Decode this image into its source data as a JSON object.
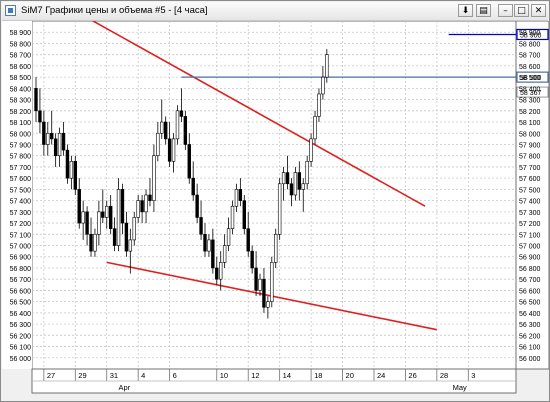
{
  "window": {
    "title": "SiM7 Графики цены и объема #5 - [4 часа]",
    "buttons": [
      {
        "name": "arrow-down-button",
        "glyph": "⬇"
      },
      {
        "name": "menu-button",
        "glyph": "▤"
      },
      {
        "name": "minimize-button",
        "glyph": "–"
      },
      {
        "name": "maximize-button",
        "glyph": "□"
      },
      {
        "name": "close-button",
        "glyph": "✕"
      }
    ]
  },
  "chart_data": {
    "type": "candlestick",
    "title": "",
    "ylim": [
      55900,
      59000
    ],
    "y_ticks": [
      56000,
      56100,
      56200,
      56300,
      56400,
      56500,
      56600,
      56700,
      56800,
      56900,
      57000,
      57100,
      57200,
      57300,
      57400,
      57500,
      57600,
      57700,
      57800,
      57900,
      58000,
      58100,
      58200,
      58300,
      58400,
      58500,
      58600,
      58700,
      58800,
      58900
    ],
    "x_tick_labels": [
      {
        "label": "27",
        "i": 2
      },
      {
        "label": "29",
        "i": 10
      },
      {
        "label": "31",
        "i": 18
      },
      {
        "label": "4",
        "i": 26
      },
      {
        "label": "6",
        "i": 34
      },
      {
        "label": "10",
        "i": 46
      },
      {
        "label": "12",
        "i": 54
      },
      {
        "label": "14",
        "i": 62
      },
      {
        "label": "18",
        "i": 70
      },
      {
        "label": "20",
        "i": 78
      },
      {
        "label": "24",
        "i": 86
      },
      {
        "label": "26",
        "i": 94
      },
      {
        "label": "28",
        "i": 102
      },
      {
        "label": "3",
        "i": 110
      }
    ],
    "month_labels": [
      {
        "label": "Apr",
        "i": 21
      },
      {
        "label": "May",
        "i": 106
      }
    ],
    "candles": [
      [
        58400,
        58500,
        58100,
        58200
      ],
      [
        58200,
        58400,
        58000,
        58100
      ],
      [
        58100,
        58200,
        57800,
        57900
      ],
      [
        57900,
        58100,
        57800,
        58000
      ],
      [
        58000,
        58200,
        57900,
        57950
      ],
      [
        57950,
        58000,
        57700,
        57800
      ],
      [
        57800,
        58050,
        57700,
        58000
      ],
      [
        58000,
        58100,
        57800,
        57850
      ],
      [
        57850,
        57900,
        57550,
        57600
      ],
      [
        57600,
        57800,
        57500,
        57750
      ],
      [
        57750,
        57800,
        57450,
        57500
      ],
      [
        57500,
        57600,
        57150,
        57200
      ],
      [
        57200,
        57400,
        57050,
        57300
      ],
      [
        57300,
        57350,
        57000,
        57100
      ],
      [
        57100,
        57250,
        56900,
        56950
      ],
      [
        56950,
        57150,
        56900,
        57100
      ],
      [
        57100,
        57400,
        57000,
        57300
      ],
      [
        57300,
        57500,
        57200,
        57250
      ],
      [
        57250,
        57400,
        57150,
        57350
      ],
      [
        57350,
        57450,
        57100,
        57150
      ],
      [
        57150,
        57250,
        56950,
        57000
      ],
      [
        57000,
        57600,
        56950,
        57500
      ],
      [
        57500,
        57550,
        57100,
        57200
      ],
      [
        57200,
        57300,
        56900,
        56950
      ],
      [
        56950,
        57150,
        56750,
        57050
      ],
      [
        57050,
        57300,
        57000,
        57250
      ],
      [
        57250,
        57450,
        57200,
        57400
      ],
      [
        57400,
        57450,
        57200,
        57300
      ],
      [
        57300,
        57500,
        57200,
        57450
      ],
      [
        57450,
        57600,
        57350,
        57400
      ],
      [
        57400,
        57900,
        57300,
        57800
      ],
      [
        57800,
        58100,
        57750,
        58000
      ],
      [
        58000,
        58300,
        57950,
        58100
      ],
      [
        58100,
        58150,
        57900,
        57950
      ],
      [
        57950,
        58100,
        57700,
        57750
      ],
      [
        57750,
        58000,
        57650,
        57950
      ],
      [
        57950,
        58250,
        57900,
        58200
      ],
      [
        58200,
        58400,
        58100,
        58150
      ],
      [
        58150,
        58200,
        57850,
        57900
      ],
      [
        57900,
        58000,
        57550,
        57600
      ],
      [
        57600,
        57750,
        57400,
        57450
      ],
      [
        57450,
        57550,
        57200,
        57250
      ],
      [
        57250,
        57400,
        57050,
        57100
      ],
      [
        57100,
        57200,
        56900,
        56950
      ],
      [
        56950,
        57100,
        56900,
        57050
      ],
      [
        57050,
        57150,
        56750,
        56800
      ],
      [
        56800,
        56900,
        56650,
        56700
      ],
      [
        56700,
        56950,
        56600,
        56850
      ],
      [
        56850,
        57100,
        56800,
        57000
      ],
      [
        57000,
        57250,
        56950,
        57150
      ],
      [
        57150,
        57400,
        57100,
        57350
      ],
      [
        57350,
        57550,
        57300,
        57500
      ],
      [
        57500,
        57600,
        57350,
        57400
      ],
      [
        57400,
        57450,
        57100,
        57150
      ],
      [
        57150,
        57300,
        56900,
        56950
      ],
      [
        56950,
        57000,
        56750,
        56800
      ],
      [
        56800,
        56950,
        56550,
        56600
      ],
      [
        56600,
        56750,
        56550,
        56700
      ],
      [
        56700,
        56800,
        56400,
        56450
      ],
      [
        56450,
        56550,
        56350,
        56500
      ],
      [
        56500,
        56900,
        56450,
        56850
      ],
      [
        56850,
        57150,
        56800,
        57100
      ],
      [
        57100,
        57600,
        57050,
        57550
      ],
      [
        57550,
        57700,
        57400,
        57650
      ],
      [
        57650,
        57800,
        57500,
        57550
      ],
      [
        57550,
        57600,
        57350,
        57450
      ],
      [
        57450,
        57700,
        57400,
        57650
      ],
      [
        57650,
        57750,
        57400,
        57500
      ],
      [
        57500,
        57600,
        57300,
        57550
      ],
      [
        57550,
        57800,
        57500,
        57750
      ],
      [
        57750,
        58000,
        57700,
        57950
      ],
      [
        57950,
        58200,
        57900,
        58150
      ],
      [
        58150,
        58400,
        58100,
        58350
      ],
      [
        58350,
        58600,
        58300,
        58500
      ],
      [
        58500,
        58750,
        58450,
        58700
      ]
    ],
    "annotations": {
      "hlines": [
        {
          "y": 58880,
          "label": "58 900",
          "color": "#0000cc",
          "x0_i": 105
        },
        {
          "y": 58500,
          "label": "58 500",
          "color": "#4a6fa0",
          "x0_i": 37
        }
      ],
      "trendlines": [
        {
          "x0_i": 14,
          "y0": 59010,
          "x1_i": 99,
          "y1": 57350,
          "color": "#e02020"
        },
        {
          "x0_i": 18,
          "y0": 56850,
          "x1_i": 102,
          "y1": 56250,
          "color": "#e02020"
        }
      ],
      "price_marker": {
        "label": "58 367",
        "y": 58367
      }
    }
  }
}
